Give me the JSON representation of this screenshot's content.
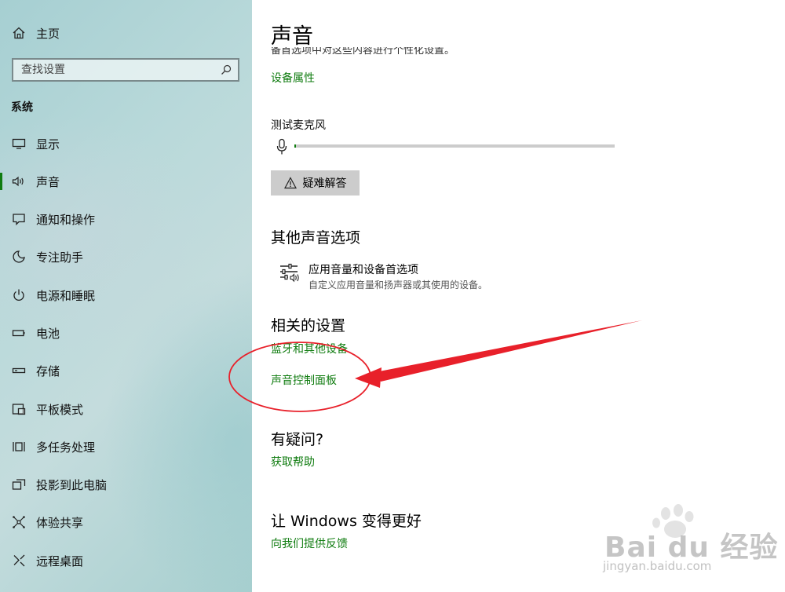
{
  "sidebar": {
    "home_label": "主页",
    "search_placeholder": "查找设置",
    "section_label": "系统",
    "items": [
      {
        "label": "显示",
        "icon": "monitor-icon"
      },
      {
        "label": "声音",
        "icon": "speaker-icon",
        "active": true
      },
      {
        "label": "通知和操作",
        "icon": "notification-icon"
      },
      {
        "label": "专注助手",
        "icon": "moon-icon"
      },
      {
        "label": "电源和睡眠",
        "icon": "power-icon"
      },
      {
        "label": "电池",
        "icon": "battery-icon"
      },
      {
        "label": "存储",
        "icon": "storage-icon"
      },
      {
        "label": "平板模式",
        "icon": "tablet-icon"
      },
      {
        "label": "多任务处理",
        "icon": "multitask-icon"
      },
      {
        "label": "投影到此电脑",
        "icon": "project-icon"
      },
      {
        "label": "体验共享",
        "icon": "share-icon"
      },
      {
        "label": "远程桌面",
        "icon": "remote-icon"
      }
    ]
  },
  "main": {
    "title": "声音",
    "cut_text": "备首选项中对这些内容进行个性化设置。",
    "device_properties_link": "设备属性",
    "test_mic_label": "测试麦克风",
    "mic_level": 0.005,
    "troubleshoot_label": "疑难解答",
    "other_options_heading": "其他声音选项",
    "app_volume": {
      "title": "应用音量和设备首选项",
      "description": "自定义应用音量和扬声器或其使用的设备。"
    },
    "related_heading": "相关的设置",
    "bluetooth_link": "蓝牙和其他设备",
    "sound_panel_link": "声音控制面板",
    "question_heading": "有疑问?",
    "help_link": "获取帮助",
    "improve_heading": "让 Windows 变得更好",
    "feedback_link": "向我们提供反馈"
  },
  "colors": {
    "accent": "#107c10",
    "annotation": "#e8202a"
  },
  "watermark": {
    "word": "Bai du 经验",
    "url": "jingyan.baidu.com"
  }
}
